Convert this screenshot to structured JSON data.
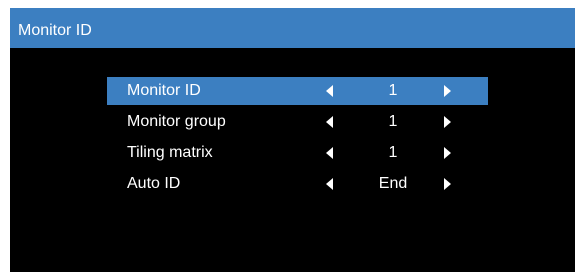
{
  "window": {
    "title": "Monitor ID"
  },
  "colors": {
    "accent": "#3c7fc1",
    "background": "#000000",
    "text": "#ffffff"
  },
  "menu": {
    "items": [
      {
        "label": "Monitor ID",
        "value": "1",
        "selected": true
      },
      {
        "label": "Monitor group",
        "value": "1",
        "selected": false
      },
      {
        "label": "Tiling matrix",
        "value": "1",
        "selected": false
      },
      {
        "label": "Auto ID",
        "value": "End",
        "selected": false
      }
    ]
  },
  "icons": {
    "decrease": "triangle-left-icon",
    "increase": "triangle-right-icon"
  }
}
